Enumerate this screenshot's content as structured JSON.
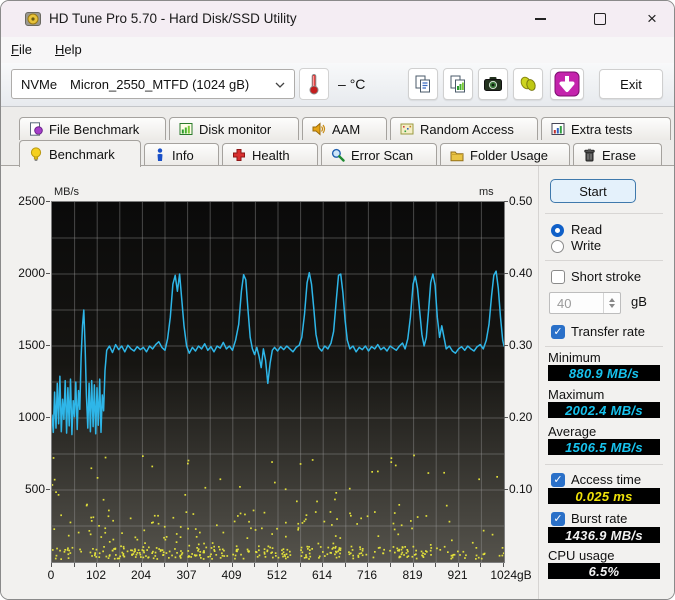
{
  "window": {
    "title": "HD Tune Pro 5.70 - Hard Disk/SSD Utility",
    "controls": {
      "minimize": "minimize",
      "maximize": "maximize",
      "close": "×"
    }
  },
  "menu": {
    "file": "File",
    "help": "Help"
  },
  "toolbar": {
    "drive_selector": {
      "bus": "NVMe",
      "model": "Micron_2550_MTFD (1024 gB)"
    },
    "temperature": {
      "value": "–",
      "unit": "°C"
    },
    "icons": {
      "thermometer": "thermometer-icon",
      "copy_text": "copy-text-to-clipboard-icon",
      "copy_image": "copy-screenshot-to-clipboard-icon",
      "screenshot": "camera-icon",
      "options": "gold-options-icon",
      "update": "purple-download-arrow-icon"
    },
    "exit_label": "Exit"
  },
  "tabs": {
    "row1": [
      {
        "label": "File Benchmark"
      },
      {
        "label": "Disk monitor"
      },
      {
        "label": "AAM"
      },
      {
        "label": "Random Access"
      },
      {
        "label": "Extra tests"
      }
    ],
    "row2": [
      {
        "label": "Benchmark",
        "active": true
      },
      {
        "label": "Info"
      },
      {
        "label": "Health"
      },
      {
        "label": "Error Scan"
      },
      {
        "label": "Folder Usage"
      },
      {
        "label": "Erase"
      }
    ]
  },
  "chart": {
    "y_left_unit": "MB/s",
    "y_right_unit": "ms",
    "y_left_tick_values": [
      2500,
      2000,
      1500,
      1000,
      500
    ],
    "y_left_tick_labels": [
      "2500",
      "2000",
      "1500",
      "1000",
      "500"
    ],
    "y_right_tick_values": [
      0.5,
      0.4,
      0.3,
      0.2,
      0.1
    ],
    "y_right_tick_labels": [
      "0.50",
      "0.40",
      "0.30",
      "0.20",
      "0.10"
    ],
    "x_tick_values": [
      0,
      102,
      204,
      307,
      409,
      512,
      614,
      716,
      819,
      921,
      1024
    ],
    "x_tick_labels": [
      "0",
      "102",
      "204",
      "307",
      "409",
      "512",
      "614",
      "716",
      "819",
      "921",
      "1024gB"
    ]
  },
  "chart_data": {
    "type": "line",
    "title": "HD Tune Pro read benchmark: transfer rate (line) and access time (scatter) vs disk position",
    "x_axis": {
      "label": "gB",
      "min": 0,
      "max": 1024,
      "ticks": [
        0,
        102,
        204,
        307,
        409,
        512,
        614,
        716,
        819,
        921,
        1024
      ]
    },
    "y_axis_left": {
      "label": "MB/s",
      "min": 0,
      "max": 2500,
      "ticks": [
        500,
        1000,
        1500,
        2000,
        2500
      ]
    },
    "y_axis_right": {
      "label": "ms",
      "min": 0,
      "max": 0.5,
      "ticks": [
        0.1,
        0.2,
        0.3,
        0.4,
        0.5
      ]
    },
    "grid": true,
    "legend_position": "none",
    "series": [
      {
        "name": "Transfer rate",
        "type": "line",
        "axis": "left",
        "color": "#2eb6e8",
        "points": [
          [
            0,
            1020
          ],
          [
            3,
            900
          ],
          [
            6,
            1180
          ],
          [
            9,
            930
          ],
          [
            12,
            1240
          ],
          [
            15,
            960
          ],
          [
            18,
            1290
          ],
          [
            21,
            905
          ],
          [
            24,
            1130
          ],
          [
            27,
            990
          ],
          [
            30,
            1260
          ],
          [
            33,
            895
          ],
          [
            36,
            1210
          ],
          [
            39,
            945
          ],
          [
            42,
            1270
          ],
          [
            45,
            885
          ],
          [
            48,
            1120
          ],
          [
            51,
            1010
          ],
          [
            54,
            1250
          ],
          [
            57,
            920
          ],
          [
            60,
            1190
          ],
          [
            63,
            1060
          ],
          [
            66,
            1420
          ],
          [
            69,
            1640
          ],
          [
            72,
            1750
          ],
          [
            75,
            1500
          ],
          [
            78,
            1160
          ],
          [
            81,
            930
          ],
          [
            84,
            1240
          ],
          [
            87,
            905
          ],
          [
            90,
            1260
          ],
          [
            93,
            940
          ],
          [
            96,
            1230
          ],
          [
            99,
            890
          ],
          [
            102,
            1210
          ],
          [
            105,
            950
          ],
          [
            108,
            1270
          ],
          [
            111,
            900
          ],
          [
            114,
            1160
          ],
          [
            117,
            1050
          ],
          [
            120,
            1330
          ],
          [
            124,
            1470
          ],
          [
            130,
            1500
          ],
          [
            137,
            1455
          ],
          [
            144,
            1510
          ],
          [
            151,
            1475
          ],
          [
            158,
            1500
          ],
          [
            165,
            1460
          ],
          [
            172,
            1505
          ],
          [
            179,
            1480
          ],
          [
            186,
            1465
          ],
          [
            193,
            1495
          ],
          [
            200,
            1475
          ],
          [
            207,
            1490
          ],
          [
            214,
            1460
          ],
          [
            221,
            1500
          ],
          [
            228,
            1480
          ],
          [
            235,
            1510
          ],
          [
            242,
            1530
          ],
          [
            249,
            1490
          ],
          [
            256,
            1470
          ],
          [
            262,
            1550
          ],
          [
            268,
            1700
          ],
          [
            274,
            1930
          ],
          [
            279,
            1990
          ],
          [
            284,
            1880
          ],
          [
            289,
            2000
          ],
          [
            294,
            1820
          ],
          [
            299,
            1640
          ],
          [
            305,
            1500
          ],
          [
            311,
            1450
          ],
          [
            318,
            1490
          ],
          [
            325,
            1465
          ],
          [
            332,
            1500
          ],
          [
            339,
            1480
          ],
          [
            346,
            1515
          ],
          [
            353,
            1470
          ],
          [
            360,
            1495
          ],
          [
            367,
            1460
          ],
          [
            374,
            1500
          ],
          [
            381,
            1485
          ],
          [
            388,
            1525
          ],
          [
            395,
            1480
          ],
          [
            402,
            1500
          ],
          [
            409,
            1470
          ],
          [
            416,
            1540
          ],
          [
            423,
            1650
          ],
          [
            429,
            1880
          ],
          [
            434,
            1995
          ],
          [
            439,
            1960
          ],
          [
            444,
            1750
          ],
          [
            449,
            1560
          ],
          [
            454,
            1480
          ],
          [
            459,
            1440
          ],
          [
            464,
            1490
          ],
          [
            469,
            1430
          ],
          [
            474,
            1350
          ],
          [
            479,
            1480
          ],
          [
            484,
            1400
          ],
          [
            489,
            1240
          ],
          [
            494,
            1380
          ],
          [
            499,
            1470
          ],
          [
            504,
            1490
          ],
          [
            511,
            1465
          ],
          [
            518,
            1495
          ],
          [
            525,
            1475
          ],
          [
            532,
            1500
          ],
          [
            539,
            1480
          ],
          [
            546,
            1460
          ],
          [
            553,
            1490
          ],
          [
            560,
            1505
          ],
          [
            566,
            1560
          ],
          [
            572,
            1720
          ],
          [
            578,
            1940
          ],
          [
            583,
            2010
          ],
          [
            588,
            1930
          ],
          [
            593,
            1760
          ],
          [
            598,
            1580
          ],
          [
            604,
            1490
          ],
          [
            611,
            1465
          ],
          [
            618,
            1500
          ],
          [
            625,
            1480
          ],
          [
            632,
            1520
          ],
          [
            638,
            1600
          ],
          [
            644,
            1820
          ],
          [
            649,
            1990
          ],
          [
            654,
            2000
          ],
          [
            659,
            1870
          ],
          [
            664,
            1680
          ],
          [
            669,
            1540
          ],
          [
            675,
            1480
          ],
          [
            682,
            1500
          ],
          [
            689,
            1460
          ],
          [
            696,
            1490
          ],
          [
            703,
            1475
          ],
          [
            710,
            1500
          ],
          [
            717,
            1465
          ],
          [
            724,
            1495
          ],
          [
            731,
            1480
          ],
          [
            738,
            1510
          ],
          [
            745,
            1475
          ],
          [
            752,
            1490
          ],
          [
            759,
            1465
          ],
          [
            766,
            1500
          ],
          [
            773,
            1485
          ],
          [
            780,
            1470
          ],
          [
            787,
            1500
          ],
          [
            794,
            1520
          ],
          [
            800,
            1480
          ],
          [
            806,
            1550
          ],
          [
            812,
            1700
          ],
          [
            818,
            1930
          ],
          [
            823,
            1985
          ],
          [
            828,
            1900
          ],
          [
            833,
            1740
          ],
          [
            838,
            1580
          ],
          [
            843,
            1500
          ],
          [
            848,
            1560
          ],
          [
            853,
            1740
          ],
          [
            858,
            1940
          ],
          [
            863,
            2000
          ],
          [
            868,
            1920
          ],
          [
            873,
            1700
          ],
          [
            878,
            1560
          ],
          [
            883,
            1640
          ],
          [
            888,
            1560
          ],
          [
            893,
            1480
          ],
          [
            900,
            1500
          ],
          [
            907,
            1465
          ],
          [
            914,
            1450
          ],
          [
            921,
            1480
          ],
          [
            928,
            1495
          ],
          [
            935,
            1470
          ],
          [
            942,
            1500
          ],
          [
            949,
            1480
          ],
          [
            956,
            1465
          ],
          [
            963,
            1495
          ],
          [
            970,
            1510
          ],
          [
            977,
            1480
          ],
          [
            984,
            1540
          ],
          [
            990,
            1650
          ],
          [
            996,
            1850
          ],
          [
            1001,
            1990
          ],
          [
            1006,
            2020
          ],
          [
            1011,
            1900
          ],
          [
            1016,
            1700
          ],
          [
            1021,
            1540
          ],
          [
            1024,
            1500
          ]
        ]
      },
      {
        "name": "Access time",
        "type": "scatter",
        "axis": "right",
        "color": "#e9e73a",
        "description": "hundreds of random access-time samples: dense band 0.004-0.022 ms along the bottom, scattered samples up to ~0.155 ms, noticeably sparser beyond ~860 gB",
        "generator": {
          "seed": 13,
          "layers": [
            {
              "count": 340,
              "ms_min": 0.004,
              "ms_max": 0.022
            },
            {
              "count": 120,
              "ms_min": 0.022,
              "ms_max": 0.07
            },
            {
              "count": 45,
              "ms_min": 0.07,
              "ms_max": 0.155
            }
          ],
          "right_thin_start_gb": 860,
          "right_thin_keep": 0.45
        }
      }
    ],
    "stats": {
      "minimum_mbs": 880.9,
      "maximum_mbs": 2002.4,
      "average_mbs": 1506.5,
      "access_time_ms": 0.025,
      "burst_rate_mbs": 1436.9,
      "cpu_usage_pct": 6.5
    }
  },
  "panel": {
    "start_label": "Start",
    "read_label": "Read",
    "write_label": "Write",
    "selected_mode": "Read",
    "short_stroke_label": "Short stroke",
    "short_stroke_checked": false,
    "short_stroke_size": "40",
    "short_stroke_unit": "gB",
    "transfer_rate_label": "Transfer rate",
    "transfer_rate_checked": true,
    "minimum_label": "Minimum",
    "minimum_value": "880.9 MB/s",
    "maximum_label": "Maximum",
    "maximum_value": "2002.4 MB/s",
    "average_label": "Average",
    "average_value": "1506.5 MB/s",
    "access_time_label": "Access time",
    "access_time_checked": true,
    "access_time_value": "0.025 ms",
    "burst_rate_label": "Burst rate",
    "burst_rate_checked": true,
    "burst_rate_value": "1436.9 MB/s",
    "cpu_usage_label": "CPU usage",
    "cpu_usage_value": "6.5%"
  },
  "colors": {
    "titlebar": "#f4edf3",
    "content_bg": "#f2f1ef",
    "plot_top": "#0a0a0a",
    "plot_bottom": "#55534c",
    "transfer_line": "#2eb6e8",
    "access_dots": "#e9e73a",
    "value_cyan": "#17c3ee",
    "value_yellow": "#efe20a",
    "value_white": "#f2f2f2",
    "accent_blue": "#2a70c8"
  },
  "checkmark": "✓"
}
